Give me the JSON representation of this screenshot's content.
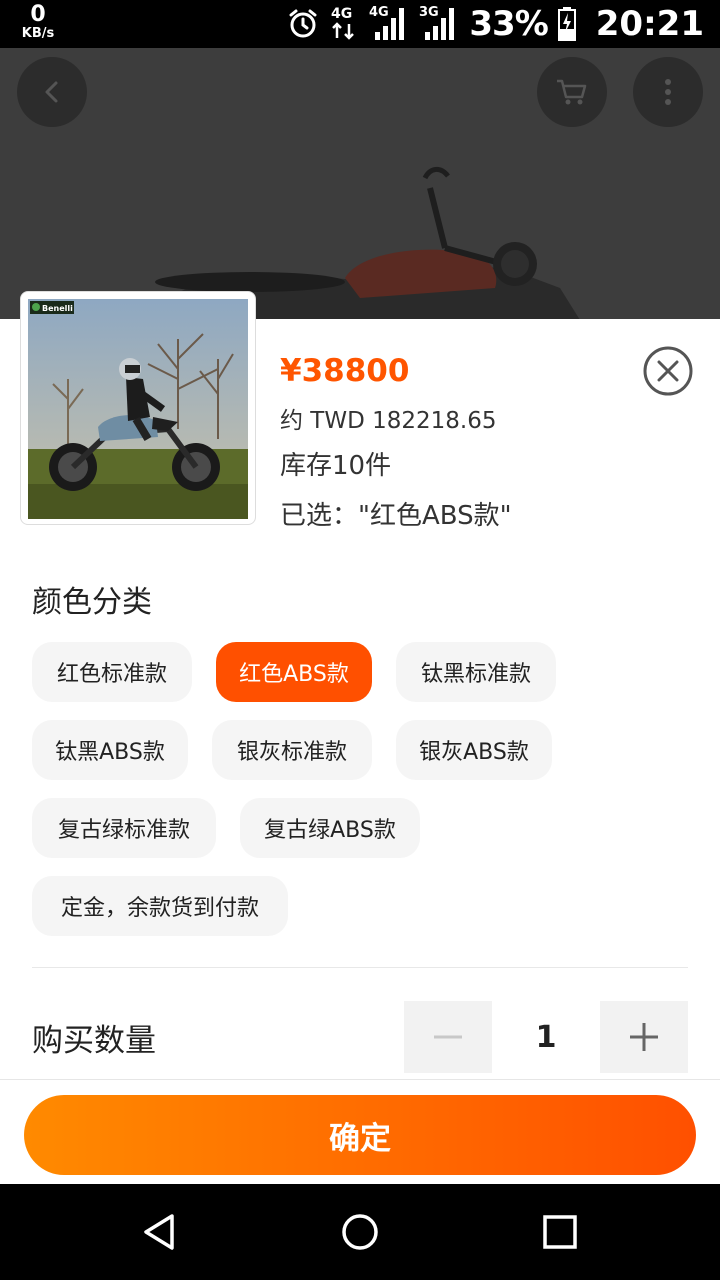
{
  "status_bar": {
    "net_speed_value": "0",
    "net_speed_unit": "KB/s",
    "signal_1_label": "4G",
    "signal_2_label": "4G",
    "signal_3_label": "3G",
    "battery_percent": "33%",
    "time": "20:21"
  },
  "hero": {
    "icons": [
      "back-icon",
      "cart-icon",
      "more-icon"
    ]
  },
  "product": {
    "price": "¥38800",
    "converted_price": "约 TWD 182218.65",
    "stock": "库存10件",
    "selected": "已选：\"红色ABS款\"",
    "thumbnail_brand": "Benelli"
  },
  "sku_section": {
    "title": "颜色分类",
    "options": [
      "红色标准款",
      "红色ABS款",
      "钛黑标准款",
      "钛黑ABS款",
      "银灰标准款",
      "银灰ABS款",
      "复古绿标准款",
      "复古绿ABS款",
      "定金，余款货到付款"
    ],
    "selected_option": "红色ABS款"
  },
  "quantity": {
    "label": "购买数量",
    "value": "1"
  },
  "confirm_label": "确定",
  "colors": {
    "accent": "#ff5000",
    "price": "#ff5500",
    "chip_bg": "#f5f5f5"
  }
}
